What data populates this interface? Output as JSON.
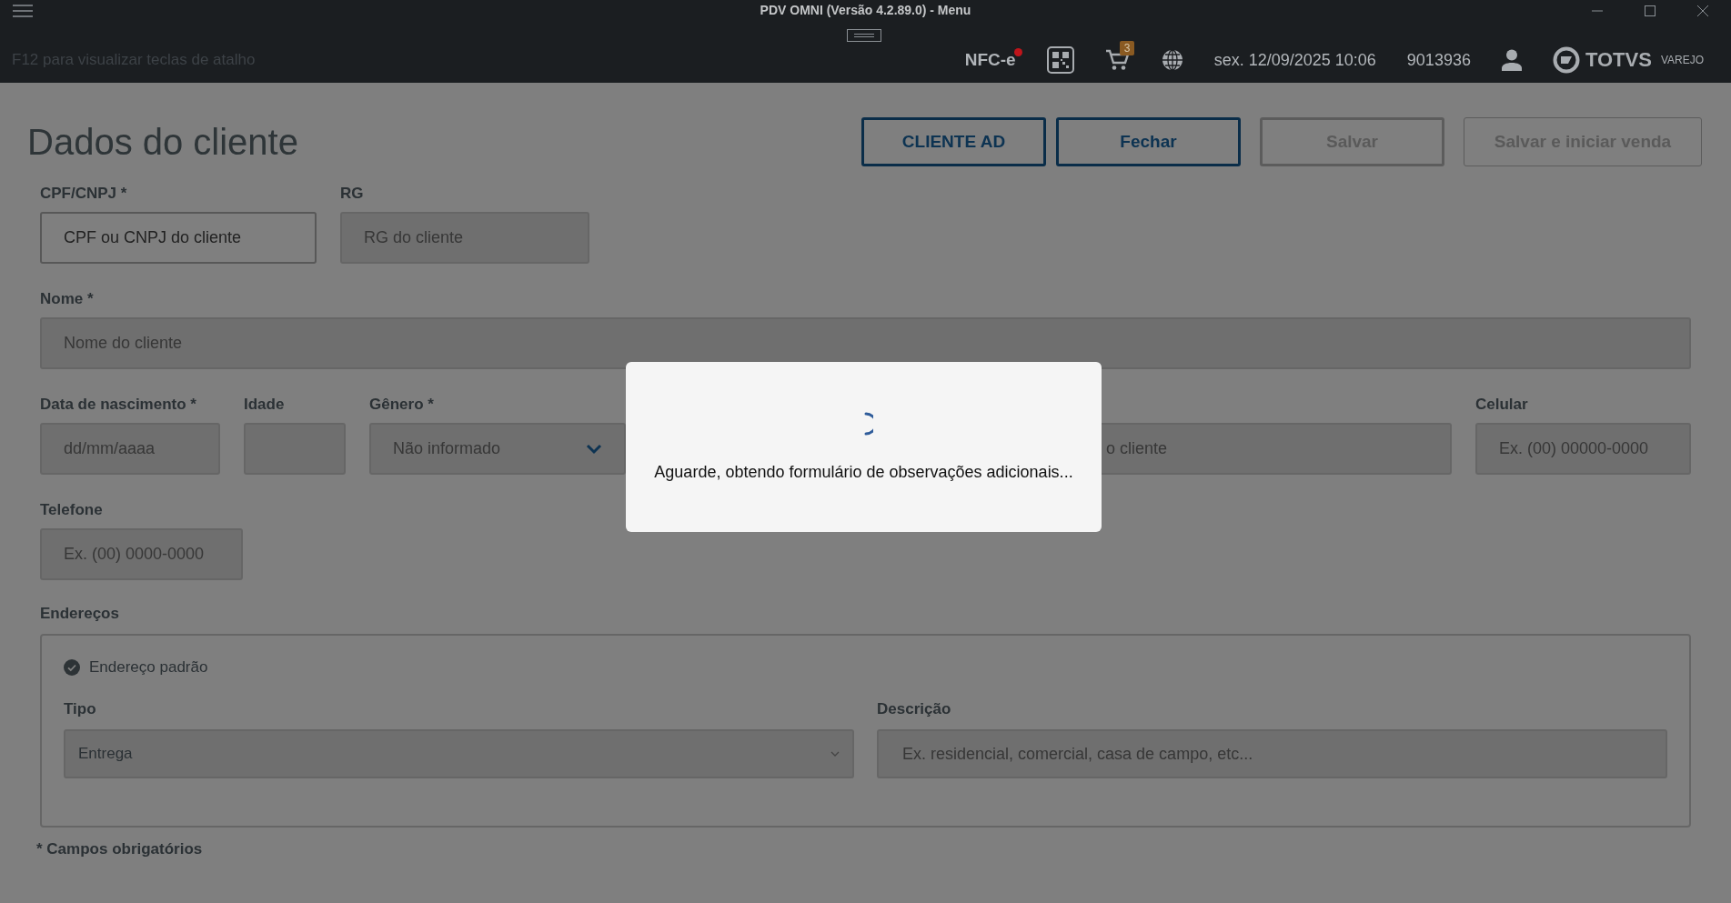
{
  "window": {
    "title": "PDV OMNI (Versão 4.2.89.0) - Menu"
  },
  "header": {
    "hint": "F12 para visualizar teclas de atalho",
    "fiscal_mode": "NFC-e",
    "fiscal_alert": true,
    "cart_count": "3",
    "datetime": "sex. 12/09/2025 10:06",
    "terminal": "9013936",
    "brand": "TOTVS",
    "brand_sub": "VAREJO"
  },
  "page": {
    "title": "Dados do cliente",
    "buttons": [
      {
        "label": "CLIENTE AD",
        "disabled": false
      },
      {
        "label": "Fechar",
        "disabled": false
      },
      {
        "label": "Salvar",
        "disabled": true
      },
      {
        "label": "Salvar e iniciar venda",
        "disabled": true
      }
    ]
  },
  "form": {
    "fields": [
      {
        "kind": "input",
        "label": "CPF/CNPJ  *",
        "placeholder": "CPF ou CNPJ do cliente",
        "disabled": false
      },
      {
        "kind": "input",
        "label": "RG",
        "placeholder": "RG do cliente",
        "disabled": true
      },
      {
        "kind": "input",
        "label": "Nome *",
        "placeholder": "Nome do cliente",
        "disabled": true
      },
      {
        "kind": "input",
        "label": "Data de nascimento *",
        "placeholder": "dd/mm/aaaa",
        "disabled": true
      },
      {
        "kind": "input",
        "label": "Idade",
        "disabled": true
      },
      {
        "kind": "select",
        "label": "Gênero *",
        "value": "Não informado",
        "disabled": true
      },
      {
        "kind": "input",
        "placeholder": "o cliente",
        "disabled": true
      },
      {
        "kind": "input",
        "label": "Celular",
        "placeholder": "Ex. (00) 00000-0000",
        "disabled": true
      },
      {
        "kind": "input",
        "label": "Telefone",
        "placeholder": "Ex. (00) 0000-0000",
        "disabled": true
      }
    ]
  },
  "addresses": {
    "label": "Endereços",
    "items": [
      {
        "default_label": "Endereço padrão",
        "default": true,
        "type_label": "Tipo",
        "type_value": "Entrega",
        "description_label": "Descrição",
        "description_placeholder": "Ex. residencial, comercial, casa de campo, etc..."
      }
    ]
  },
  "footnote": "* Campos obrigatórios",
  "dialog": {
    "message": "Aguarde, obtendo formulário de observações adicionais..."
  }
}
